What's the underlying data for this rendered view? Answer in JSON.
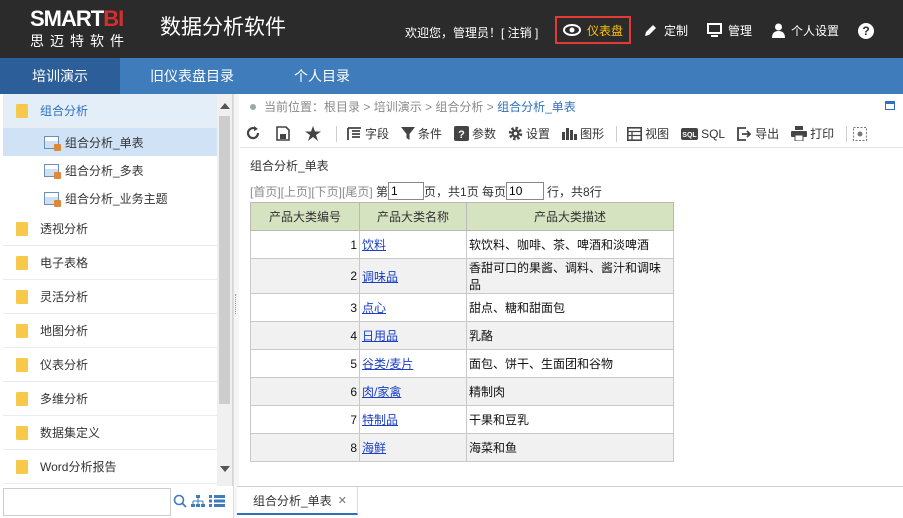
{
  "header": {
    "logo_main_prefix": "SMART",
    "logo_main_suffix": "BI",
    "logo_sub": "思迈特软件",
    "app_title": "数据分析软件",
    "welcome": "欢迎您，管理员！[ 注销 ]",
    "nav": [
      {
        "label": "仪表盘",
        "icon": "eye-icon",
        "active": true
      },
      {
        "label": "定制",
        "icon": "pencil-icon"
      },
      {
        "label": "管理",
        "icon": "monitor-icon"
      },
      {
        "label": "个人设置",
        "icon": "user-icon"
      }
    ],
    "help": "?"
  },
  "tabs": [
    {
      "label": "培训演示",
      "active": true
    },
    {
      "label": "旧仪表盘目录"
    },
    {
      "label": "个人目录"
    }
  ],
  "sidebar": {
    "items": [
      {
        "label": "组合分析",
        "open": true
      },
      {
        "label": "透视分析"
      },
      {
        "label": "电子表格"
      },
      {
        "label": "灵活分析"
      },
      {
        "label": "地图分析"
      },
      {
        "label": "仪表分析"
      },
      {
        "label": "多维分析"
      },
      {
        "label": "数据集定义"
      },
      {
        "label": "Word分析报告"
      }
    ],
    "subitems": [
      {
        "label": "组合分析_单表",
        "selected": true
      },
      {
        "label": "组合分析_多表"
      },
      {
        "label": "组合分析_业务主题"
      }
    ],
    "search_placeholder": ""
  },
  "breadcrumb": {
    "prefix": "当前位置：",
    "path": [
      "根目录",
      "培训演示",
      "组合分析"
    ],
    "current": "组合分析_单表",
    "sep": " > "
  },
  "toolbar": [
    {
      "label": "",
      "icon": "refresh-icon"
    },
    {
      "label": "",
      "icon": "save-icon"
    },
    {
      "label": "",
      "icon": "star-icon"
    },
    {
      "label": "字段",
      "icon": "field-icon"
    },
    {
      "label": "条件",
      "icon": "filter-icon"
    },
    {
      "label": "参数",
      "icon": "param-icon"
    },
    {
      "label": "设置",
      "icon": "gear-icon"
    },
    {
      "label": "图形",
      "icon": "chart-icon"
    },
    {
      "label": "视图",
      "icon": "view-icon"
    },
    {
      "label": "SQL",
      "icon": "sql-icon"
    },
    {
      "label": "导出",
      "icon": "export-icon"
    },
    {
      "label": "打印",
      "icon": "print-icon"
    }
  ],
  "report": {
    "title": "组合分析_单表",
    "pager": {
      "first": "[首页]",
      "prev": "[上页]",
      "next": "[下页]",
      "last": "[尾页]",
      "page_prefix": " 第",
      "page_value": "1",
      "page_suffix": "页，共1页 每页",
      "per_page_value": "10",
      "total": "行，共8行"
    },
    "columns": [
      "产品大类编号",
      "产品大类名称",
      "产品大类描述"
    ],
    "rows": [
      {
        "id": "1",
        "name": "饮料",
        "desc": "软饮料、咖啡、茶、啤酒和淡啤酒"
      },
      {
        "id": "2",
        "name": "调味品",
        "desc": "香甜可口的果酱、调料、酱汁和调味品"
      },
      {
        "id": "3",
        "name": "点心",
        "desc": "甜点、糖和甜面包"
      },
      {
        "id": "4",
        "name": "日用品",
        "desc": "乳酪"
      },
      {
        "id": "5",
        "name": "谷类/麦片",
        "desc": "面包、饼干、生面团和谷物"
      },
      {
        "id": "6",
        "name": "肉/家禽",
        "desc": "精制肉"
      },
      {
        "id": "7",
        "name": "特制品",
        "desc": "干果和豆乳"
      },
      {
        "id": "8",
        "name": "海鲜",
        "desc": "海菜和鱼"
      }
    ]
  },
  "bottom_tab": {
    "label": "组合分析_单表",
    "close": "✕"
  },
  "colors": {
    "header_bg": "#2b2b2b",
    "tab_bar": "#3e7cbc",
    "tab_active": "#2c5f99",
    "accent_yellow": "#ffc107",
    "table_header": "#d6e3c1",
    "link": "#1a3fc4"
  }
}
